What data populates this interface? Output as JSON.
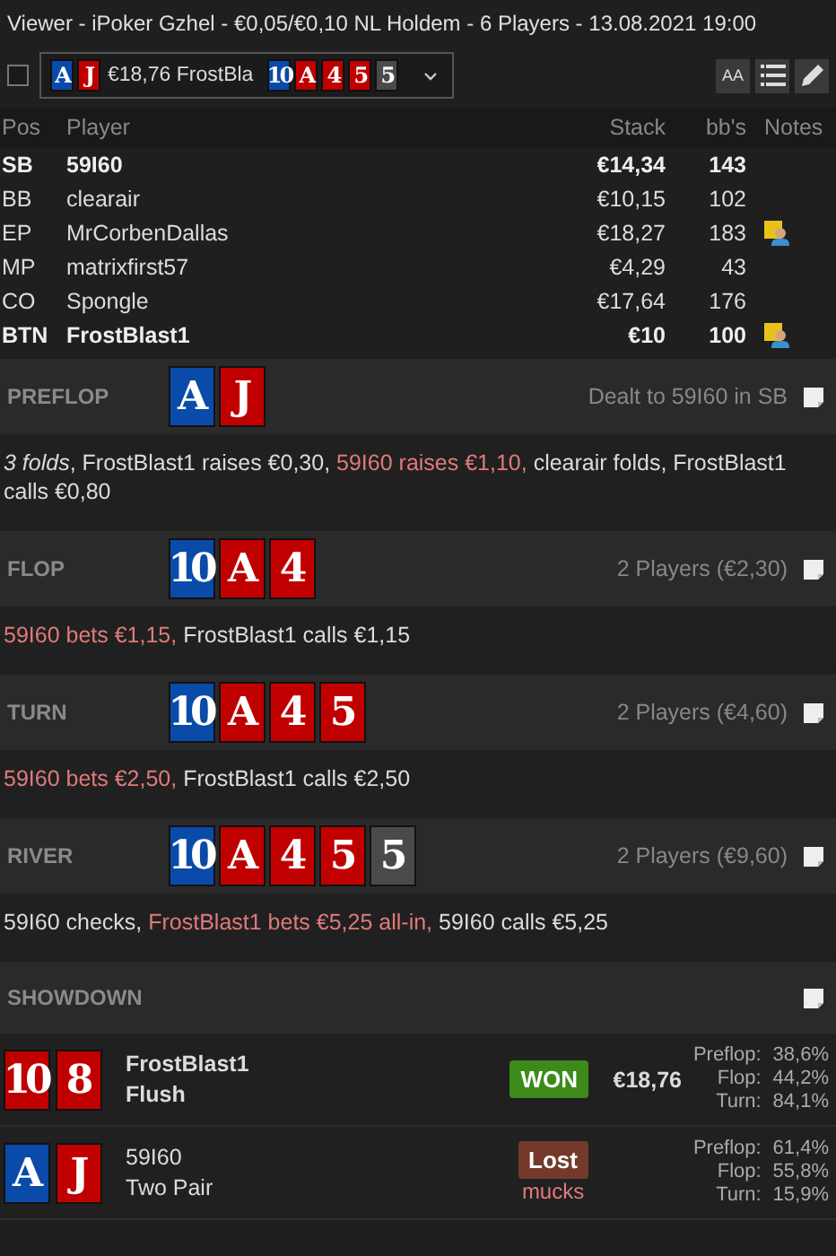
{
  "window": {
    "title": "Viewer - iPoker Gzhel - €0,05/€0,10 NL Holdem - 6 Players - 13.08.2021 19:00"
  },
  "toolbar": {
    "checked": false,
    "hand_cards": [
      {
        "rank": "A",
        "color": "#0a4aa8"
      },
      {
        "rank": "J",
        "color": "#c00000"
      }
    ],
    "summary": "€18,76 FrostBla",
    "board_cards": [
      {
        "rank": "10",
        "color": "#0a4aa8"
      },
      {
        "rank": "A",
        "color": "#c00000"
      },
      {
        "rank": "4",
        "color": "#c00000"
      },
      {
        "rank": "5",
        "color": "#c00000"
      },
      {
        "rank": "5",
        "color": "#4a4a4a"
      }
    ],
    "font_button": "AA"
  },
  "players": {
    "columns": [
      "Pos",
      "Player",
      "Stack",
      "bb's",
      "Notes"
    ],
    "rows": [
      {
        "pos": "SB",
        "name": "59I60",
        "stack": "€14,34",
        "bbs": "143",
        "highlighted": true,
        "has_note": false
      },
      {
        "pos": "BB",
        "name": "clearair",
        "stack": "€10,15",
        "bbs": "102",
        "highlighted": false,
        "has_note": false
      },
      {
        "pos": "EP",
        "name": "MrCorbenDallas",
        "stack": "€18,27",
        "bbs": "183",
        "highlighted": false,
        "has_note": true
      },
      {
        "pos": "MP",
        "name": "matrixfirst57",
        "stack": "€4,29",
        "bbs": "43",
        "highlighted": false,
        "has_note": false
      },
      {
        "pos": "CO",
        "name": "Spongle",
        "stack": "€17,64",
        "bbs": "176",
        "highlighted": false,
        "has_note": false
      },
      {
        "pos": "BTN",
        "name": "FrostBlast1",
        "stack": "€10",
        "bbs": "100",
        "highlighted": true,
        "has_note": true
      }
    ]
  },
  "streets": [
    {
      "name": "PREFLOP",
      "cards": [
        {
          "rank": "A",
          "color": "#0a4aa8"
        },
        {
          "rank": "J",
          "color": "#c00000"
        }
      ],
      "info": "Dealt to 59I60 in SB",
      "actions": [
        {
          "text": "*3 folds*, FrostBlast1 raises €0,30, ",
          "highlight": false
        },
        {
          "text": "59I60 raises €1,10, ",
          "highlight": true
        },
        {
          "text": "clearair folds, FrostBlast1 calls €0,80",
          "highlight": false
        }
      ]
    },
    {
      "name": "FLOP",
      "cards": [
        {
          "rank": "10",
          "color": "#0a4aa8"
        },
        {
          "rank": "A",
          "color": "#c00000"
        },
        {
          "rank": "4",
          "color": "#c00000"
        }
      ],
      "info": "2 Players (€2,30)",
      "actions": [
        {
          "text": "59I60 bets €1,15, ",
          "highlight": true
        },
        {
          "text": "FrostBlast1 calls €1,15",
          "highlight": false
        }
      ]
    },
    {
      "name": "TURN",
      "cards": [
        {
          "rank": "10",
          "color": "#0a4aa8"
        },
        {
          "rank": "A",
          "color": "#c00000"
        },
        {
          "rank": "4",
          "color": "#c00000"
        },
        {
          "rank": "5",
          "color": "#c00000"
        }
      ],
      "info": "2 Players (€4,60)",
      "actions": [
        {
          "text": "59I60 bets €2,50, ",
          "highlight": true
        },
        {
          "text": "FrostBlast1 calls €2,50",
          "highlight": false
        }
      ]
    },
    {
      "name": "RIVER",
      "cards": [
        {
          "rank": "10",
          "color": "#0a4aa8"
        },
        {
          "rank": "A",
          "color": "#c00000"
        },
        {
          "rank": "4",
          "color": "#c00000"
        },
        {
          "rank": "5",
          "color": "#c00000"
        },
        {
          "rank": "5",
          "color": "#4a4a4a"
        }
      ],
      "info": "2 Players (€9,60)",
      "actions": [
        {
          "text": "59I60 checks, ",
          "highlight": false
        },
        {
          "text": "FrostBlast1 bets €5,25 all-in, ",
          "highlight": true
        },
        {
          "text": "59I60 calls €5,25",
          "highlight": false
        }
      ]
    }
  ],
  "showdown": {
    "title": "SHOWDOWN",
    "results": [
      {
        "cards": [
          {
            "rank": "10",
            "color": "#c00000"
          },
          {
            "rank": "8",
            "color": "#c00000"
          }
        ],
        "name": "FrostBlast1",
        "hand": "Flush",
        "winner": true,
        "result": "WON",
        "amount": "€18,76",
        "equity": [
          {
            "label": "Preflop:",
            "value": "38,6%"
          },
          {
            "label": "Flop:",
            "value": "44,2%"
          },
          {
            "label": "Turn:",
            "value": "84,1%"
          }
        ]
      },
      {
        "cards": [
          {
            "rank": "A",
            "color": "#0a4aa8"
          },
          {
            "rank": "J",
            "color": "#c00000"
          }
        ],
        "name": "59I60",
        "hand": "Two Pair",
        "winner": false,
        "result": "Lost",
        "note": "mucks",
        "equity": [
          {
            "label": "Preflop:",
            "value": "61,4%"
          },
          {
            "label": "Flop:",
            "value": "55,8%"
          },
          {
            "label": "Turn:",
            "value": "15,9%"
          }
        ]
      }
    ]
  }
}
